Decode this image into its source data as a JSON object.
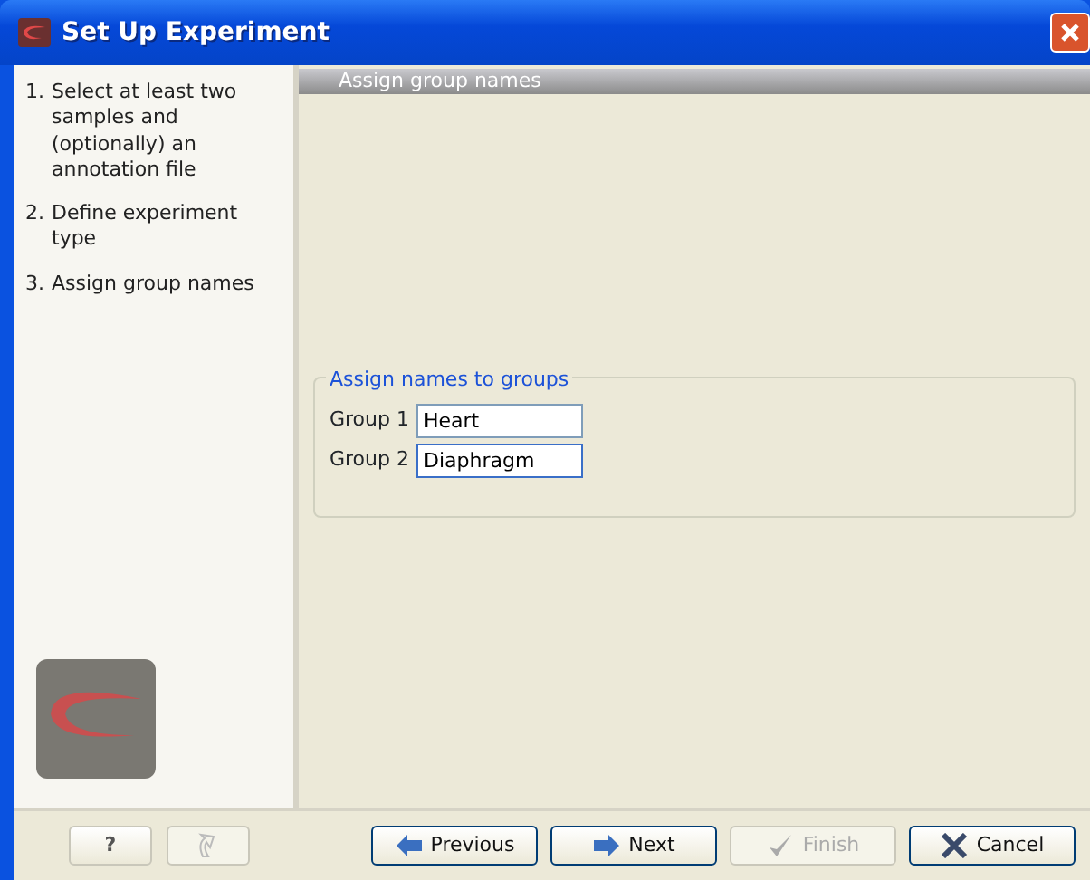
{
  "window": {
    "title": "Set Up Experiment"
  },
  "steps": [
    {
      "number": "1.",
      "label": "Select at least two samples and (optionally) an annotation file"
    },
    {
      "number": "2.",
      "label": "Define experiment type"
    },
    {
      "number": "3.",
      "label": "Assign group names"
    }
  ],
  "panel": {
    "header": "Assign group names",
    "group_title": "Assign names to groups",
    "fields": [
      {
        "label": "Group 1",
        "value": "Heart",
        "focused": false
      },
      {
        "label": "Group 2",
        "value": "Diaphragm",
        "focused": true
      }
    ]
  },
  "left_buttons": [
    {
      "kind": "help",
      "label": "?",
      "disabled": false
    },
    {
      "kind": "revert",
      "disabled": true
    }
  ],
  "buttons": [
    {
      "kind": "previous",
      "label": "Previous",
      "disabled": false
    },
    {
      "kind": "next",
      "label": "Next",
      "disabled": false
    },
    {
      "kind": "finish",
      "label": "Finish",
      "disabled": true
    },
    {
      "kind": "cancel",
      "label": "Cancel",
      "disabled": false
    }
  ]
}
